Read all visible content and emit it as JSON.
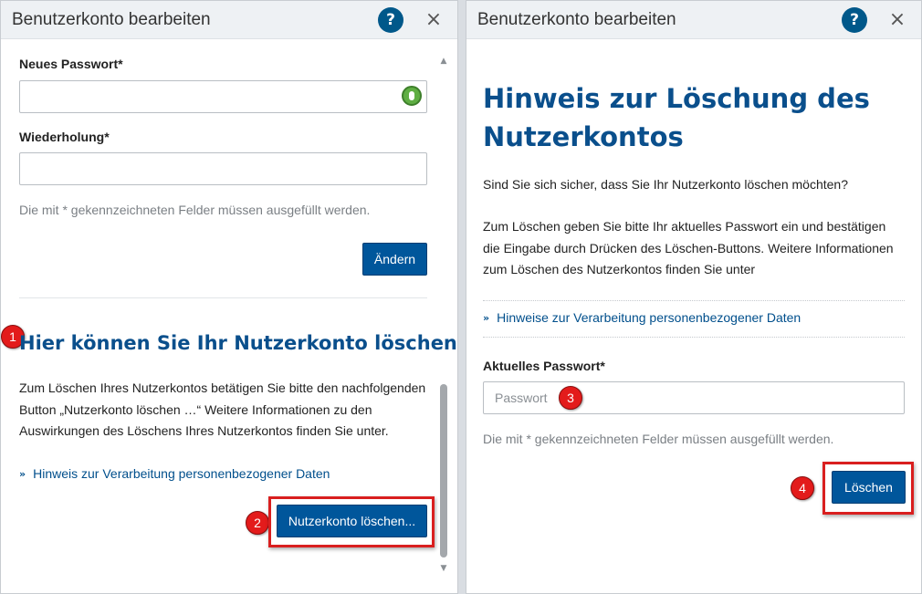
{
  "left_dialog": {
    "title": "Benutzerkonto bearbeiten",
    "help_label": "?",
    "close_label": "×",
    "new_password_label": "Neues Passwort*",
    "repeat_label": "Wiederholung*",
    "required_hint": "Die mit * gekennzeichneten Felder müssen ausgefüllt werden.",
    "change_button": "Ändern",
    "delete_heading": "Hier können Sie Ihr Nutzerkonto löschen",
    "delete_text": "Zum Löschen Ihres Nutzerkontos betätigen Sie bitte den nachfolgenden Button „Nutzerkonto löschen …“ Weitere Informationen zu den Auswirkungen des Löschens Ihres Nutzerkontos finden Sie unter.",
    "privacy_link": "Hinweis zur Verarbeitung personenbezogener Daten",
    "delete_button": "Nutzerkonto löschen..."
  },
  "right_dialog": {
    "title": "Benutzerkonto bearbeiten",
    "help_label": "?",
    "close_label": "×",
    "heading": "Hinweis zur Löschung des Nutzerkontos",
    "question": "Sind Sie sich sicher, dass Sie Ihr Nutzerkonto löschen möchten?",
    "instructions": "Zum Löschen geben Sie bitte Ihr aktuelles Passwort ein und bestätigen die Eingabe durch Drücken des Löschen-Buttons. Weitere Informationen zum Löschen des Nutzerkontos finden Sie unter",
    "privacy_link": "Hinweise zur Verarbeitung personenbezogener Daten",
    "current_password_label": "Aktuelles Passwort*",
    "password_placeholder": "Passwort",
    "required_hint": "Die mit * gekennzeichneten Felder müssen ausgefüllt werden.",
    "delete_button": "Löschen"
  },
  "markers": [
    "1",
    "2",
    "3",
    "4"
  ],
  "colors": {
    "accent": "#00569b",
    "heading": "#0a4f8c",
    "marker": "#e31b1b"
  },
  "icons": {
    "link_chevron": "»",
    "scroll_up": "▲",
    "scroll_down": "▼"
  }
}
